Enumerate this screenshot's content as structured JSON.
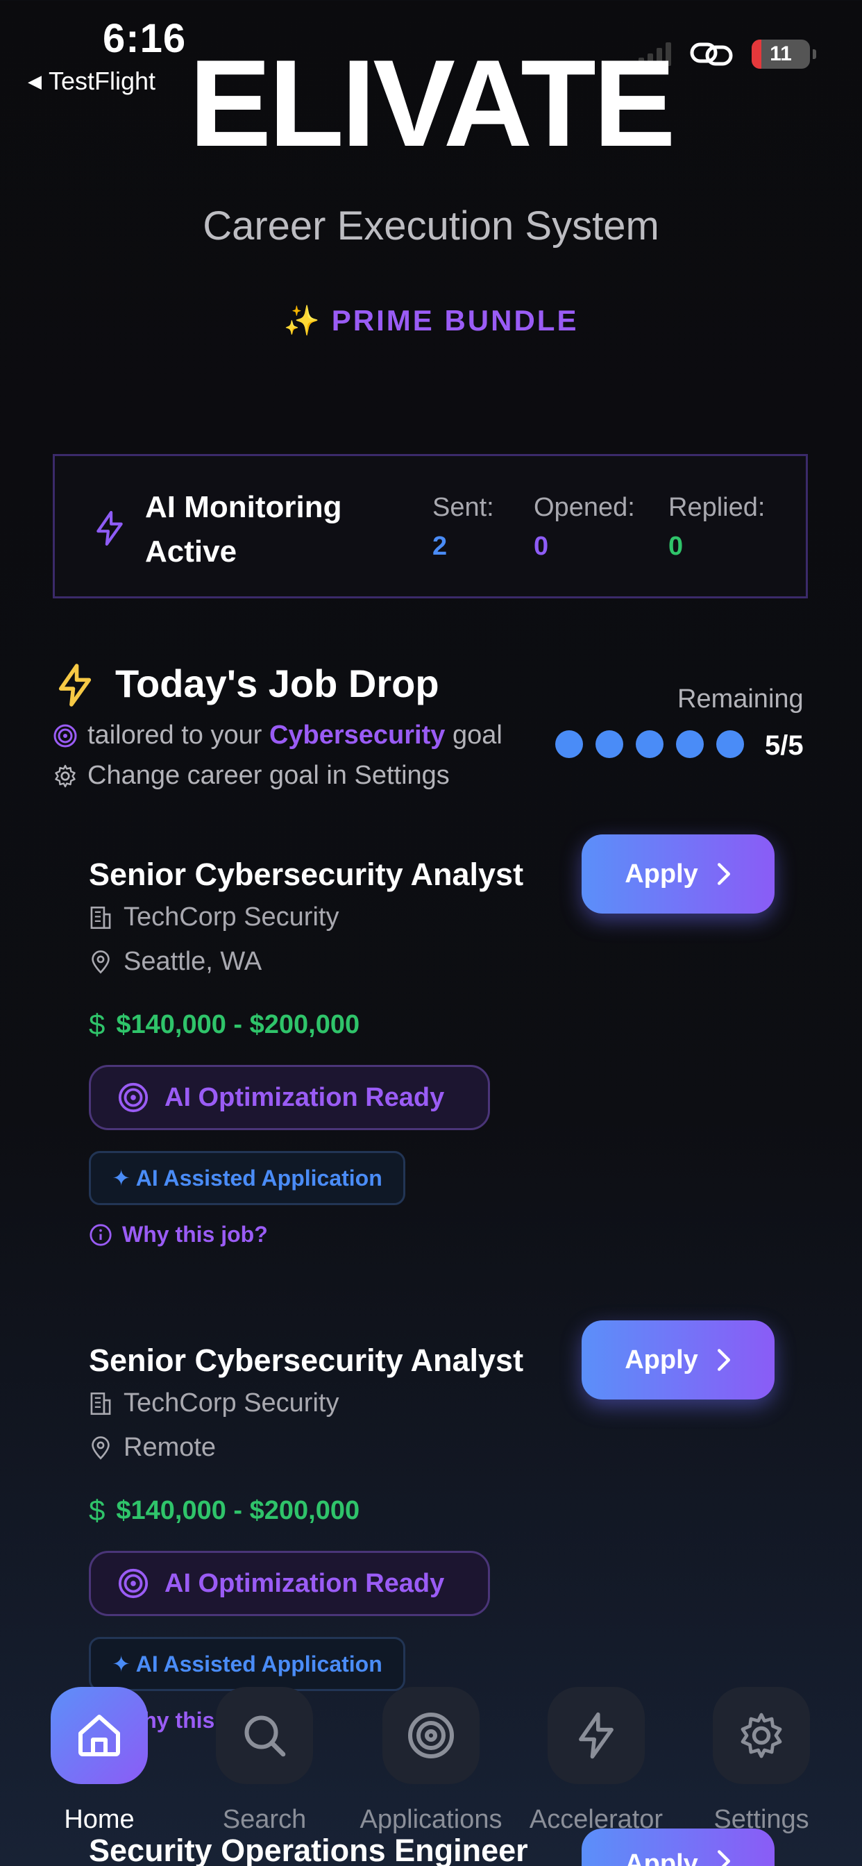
{
  "status_bar": {
    "time": "6:16",
    "back_label": "TestFlight",
    "battery": "11"
  },
  "header": {
    "logo": "ELIVATE",
    "subtitle": "Career Execution System",
    "bundle_icon": "✨",
    "bundle": "PRIME BUNDLE"
  },
  "monitoring": {
    "title": "AI Monitoring Active",
    "stats": [
      {
        "label": "Sent:",
        "value": "2"
      },
      {
        "label": "Opened:",
        "value": "0"
      },
      {
        "label": "Replied:",
        "value": "0"
      }
    ]
  },
  "job_drop": {
    "title": "Today's Job Drop",
    "tailored_prefix": "tailored to your",
    "goal": "Cybersecurity",
    "tailored_suffix": "goal",
    "change_goal": "Change career goal in Settings",
    "remaining_label": "Remaining",
    "remaining_count": "5/5",
    "remaining_fraction": 1.0
  },
  "jobs": [
    {
      "title": "Senior Cybersecurity Analyst",
      "company": "TechCorp Security",
      "location": "Seattle, WA",
      "salary": "$140,000 - $200,000",
      "optimization": "AI Optimization Ready",
      "assisted": "✦ AI Assisted Application",
      "why": "Why this job?",
      "apply": "Apply"
    },
    {
      "title": "Senior Cybersecurity Analyst",
      "company": "TechCorp Security",
      "location": "Remote",
      "salary": "$140,000 - $200,000",
      "optimization": "AI Optimization Ready",
      "assisted": "✦ AI Assisted Application",
      "why": "Why this job?",
      "apply": "Apply"
    },
    {
      "title": "Security Operations Engineer",
      "apply": "Apply"
    }
  ],
  "tabs": [
    {
      "label": "Home",
      "icon": "home-icon",
      "active": true
    },
    {
      "label": "Search",
      "icon": "search-icon",
      "active": false
    },
    {
      "label": "Applications",
      "icon": "target-icon",
      "active": false
    },
    {
      "label": "Accelerator",
      "icon": "bolt-icon",
      "active": false
    },
    {
      "label": "Settings",
      "icon": "gear-icon",
      "active": false
    }
  ],
  "colors": {
    "accent_purple": "#9a5cf5",
    "accent_blue": "#4a8cf7",
    "success_green": "#2fc46a",
    "background": "#0b0b0e"
  }
}
